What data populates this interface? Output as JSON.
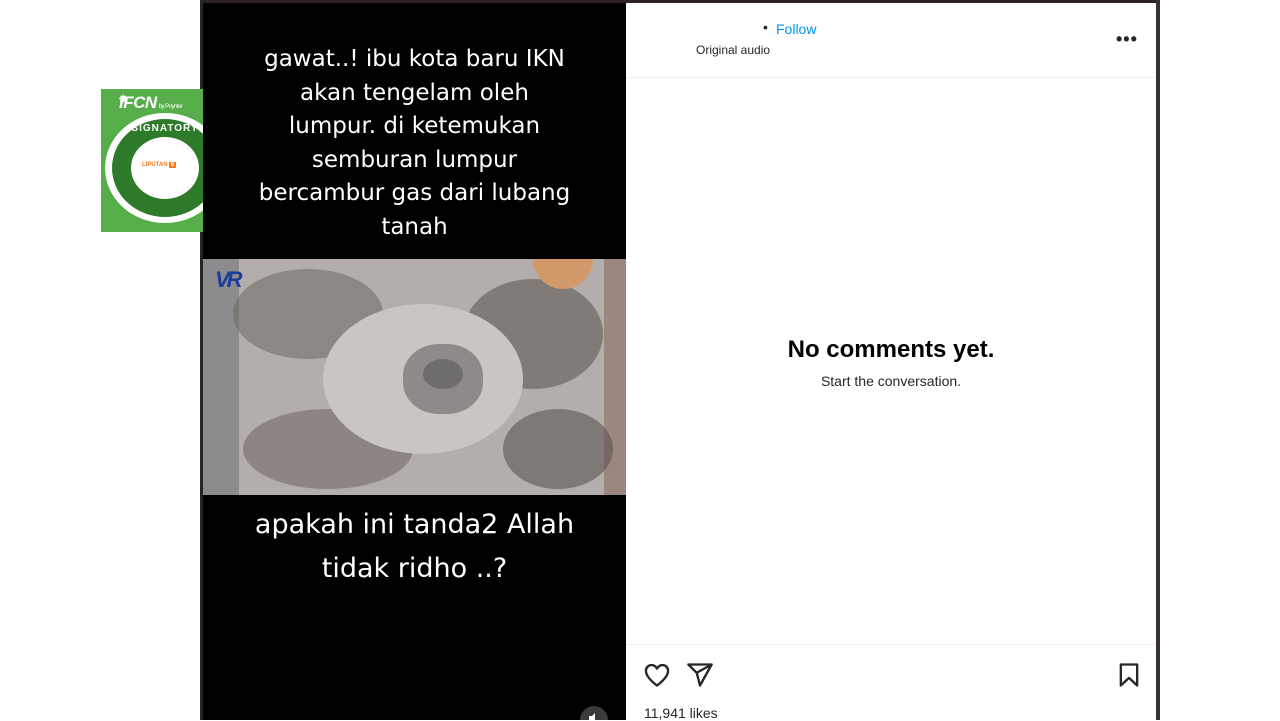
{
  "badge": {
    "logo": "IFCN",
    "logo_sub": "by Poynter",
    "ring_text": "SIGNATORY",
    "member": "LIPUTAN",
    "member_mark": "6"
  },
  "post": {
    "caption_top": "gawat..! ibu kota baru IKN\nakan tengelam oleh\nlumpur. di ketemukan\nsemburan lumpur\nbercambur gas dari lubang\ntanah",
    "caption_bottom": "apakah ini tanda2 Allah\ntidak ridho ..?",
    "video_watermark": "VR",
    "mute_icon": "speaker-muted-icon"
  },
  "header": {
    "username": "",
    "separator": "•",
    "follow_label": "Follow",
    "audio_label": "Original audio",
    "more_label": "•••"
  },
  "comments": {
    "empty_title": "No comments yet.",
    "empty_subtitle": "Start the conversation."
  },
  "actions": {
    "likes": "11,941 likes"
  },
  "colors": {
    "accent": "#0095f6",
    "badge_green": "#56ad4a",
    "liputan_orange": "#f47920"
  }
}
